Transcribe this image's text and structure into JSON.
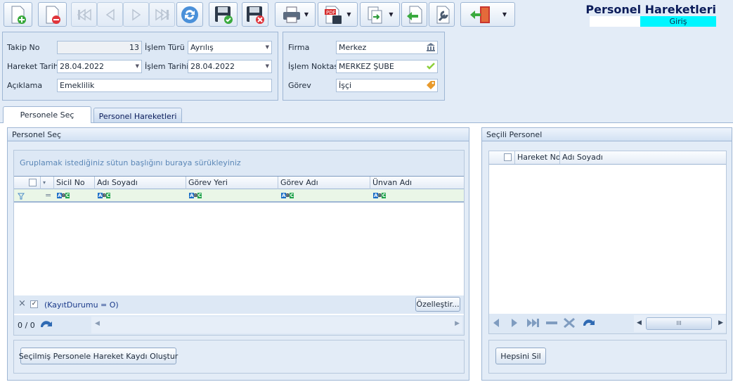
{
  "header": {
    "title": "Personel Hareketleri",
    "mode": "Giriş"
  },
  "colors": {
    "accent_title": "#0b1c5a",
    "mode_badge": "#00f6ff",
    "panel_bg": "#dde8f5",
    "border": "#9eb6d4"
  },
  "toolbar": {
    "buttons": [
      {
        "name": "new-icon"
      },
      {
        "name": "delete-icon"
      },
      {
        "name": "first-record-icon"
      },
      {
        "name": "prev-record-icon"
      },
      {
        "name": "next-record-icon"
      },
      {
        "name": "last-record-icon"
      },
      {
        "name": "refresh-icon"
      },
      {
        "name": "save-icon"
      },
      {
        "name": "cancel-save-icon"
      },
      {
        "name": "print-icon"
      },
      {
        "name": "pdf-export-icon"
      },
      {
        "name": "export-icon"
      },
      {
        "name": "back-icon"
      },
      {
        "name": "settings-tool-icon"
      },
      {
        "name": "exit-door-icon"
      }
    ]
  },
  "form_left": {
    "takip_no_label": "Takip No",
    "takip_no_value": "13",
    "islem_turu_label": "İşlem Türü",
    "islem_turu_value": "Ayrılış",
    "hareket_tarih_label": "Hareket Tarih",
    "hareket_tarih_value": "28.04.2022",
    "islem_tarihi_label": "İşlem Tarihi",
    "islem_tarihi_value": "28.04.2022",
    "aciklama_label": "Açıklama",
    "aciklama_value": "Emeklilik"
  },
  "form_right": {
    "firma_label": "Firma",
    "firma_value": "Merkez",
    "islem_noktasi_label": "İşlem Noktası",
    "islem_noktasi_value": "MERKEZ ŞUBE",
    "gorev_label": "Görev",
    "gorev_value": "İşçi"
  },
  "tabs": [
    {
      "label": "Personele Seç",
      "active": true
    },
    {
      "label": "Personel Hareketleri",
      "active": false
    }
  ],
  "left_group": {
    "title": "Personel Seç",
    "group_hint": "Gruplamak istediğiniz sütun başlığını buraya sürükleyiniz",
    "columns": [
      "Sicil No",
      "Adı Soyadı",
      "Görev Yeri",
      "Görev Adı",
      "Ünvan Adı"
    ],
    "filter_text": "(KayıtDurumu = O)",
    "customize_label": "Özelleştir...",
    "record_count": "0 / 0",
    "action_button": "Seçilmiş Personele Hareket Kaydı Oluştur"
  },
  "right_group": {
    "title": "Seçili Personel",
    "columns": [
      "Hareket No",
      "Adı Soyadı"
    ],
    "scroll_thumb": "III",
    "delete_all_button": "Hepsini Sil"
  }
}
